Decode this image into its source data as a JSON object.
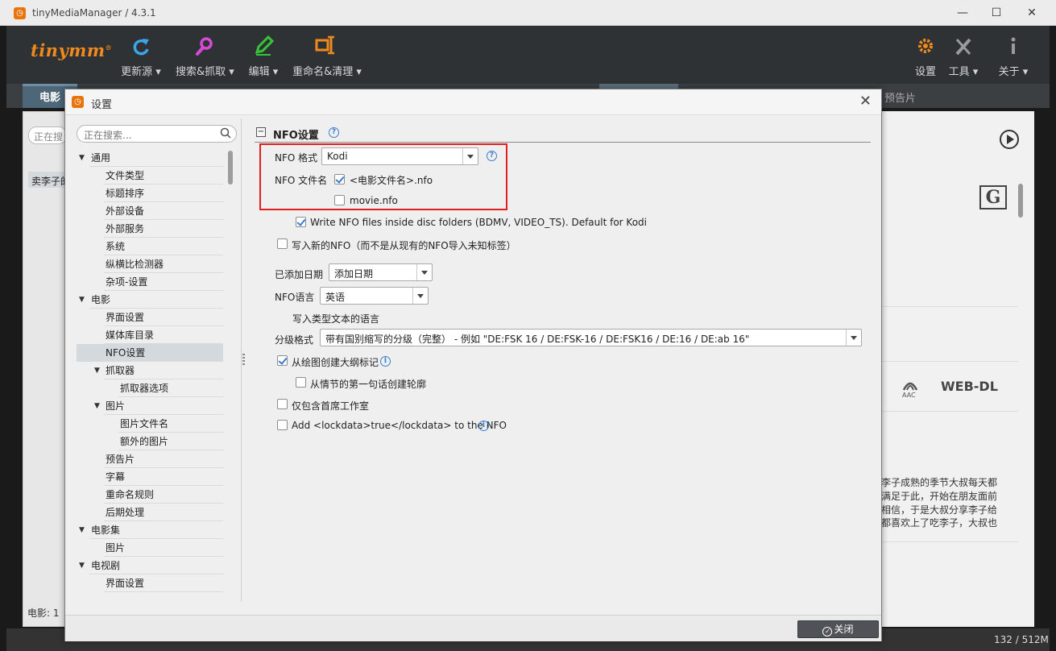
{
  "window": {
    "title": "tinyMediaManager / 4.3.1",
    "minimize": "—",
    "maximize": "☐",
    "close": "✕"
  },
  "toolbar": {
    "logo": "tinymm",
    "logo_mark": "®",
    "update_source": "更新源 ▾",
    "search_scrape": "搜索&抓取 ▾",
    "edit": "编辑 ▾",
    "rename_clean": "重命名&清理 ▾",
    "settings": "设置",
    "tools": "工具 ▾",
    "about": "关于 ▾"
  },
  "tabs": {
    "movie": "电影",
    "trailer": "预告片"
  },
  "background": {
    "search_placeholder": "正在搜",
    "selected_movie": "卖李子的",
    "status_count": "电影: 1",
    "memory": "132 / 512M",
    "rating_badge": "G",
    "web_dl": "WEB-DL",
    "aac": "AAC",
    "plot_lines": [
      "李子成熟的季节大叔每天都",
      "满足于此，开始在朋友面前",
      "相信，于是大叔分享李子给",
      "都喜欢上了吃李子，大叔也"
    ]
  },
  "dialog": {
    "title": "设置",
    "close_icon": "✕",
    "search_placeholder": "正在搜索...",
    "tree": [
      {
        "label": "通用",
        "level": 0,
        "expanded": true
      },
      {
        "label": "文件类型",
        "level": 1
      },
      {
        "label": "标题排序",
        "level": 1
      },
      {
        "label": "外部设备",
        "level": 1
      },
      {
        "label": "外部服务",
        "level": 1
      },
      {
        "label": "系统",
        "level": 1
      },
      {
        "label": "纵横比检测器",
        "level": 1
      },
      {
        "label": "杂项-设置",
        "level": 1
      },
      {
        "label": "电影",
        "level": 0,
        "expanded": true
      },
      {
        "label": "界面设置",
        "level": 1
      },
      {
        "label": "媒体库目录",
        "level": 1
      },
      {
        "label": "NFO设置",
        "level": 1,
        "selected": true
      },
      {
        "label": "抓取器",
        "level": 1,
        "expanded": true
      },
      {
        "label": "抓取器选项",
        "level": 2
      },
      {
        "label": "图片",
        "level": 1,
        "expanded": true
      },
      {
        "label": "图片文件名",
        "level": 2
      },
      {
        "label": "额外的图片",
        "level": 2
      },
      {
        "label": "预告片",
        "level": 1
      },
      {
        "label": "字幕",
        "level": 1
      },
      {
        "label": "重命名规则",
        "level": 1
      },
      {
        "label": "后期处理",
        "level": 1
      },
      {
        "label": "电影集",
        "level": 0,
        "expanded": true
      },
      {
        "label": "图片",
        "level": 1
      },
      {
        "label": "电视剧",
        "level": 0,
        "expanded": true
      },
      {
        "label": "界面设置",
        "level": 1
      }
    ],
    "panel": {
      "title": "NFO设置",
      "nfo_format_label": "NFO 格式",
      "nfo_format_value": "Kodi",
      "nfo_filename_label": "NFO 文件名",
      "nfo_filename_opt1": "<电影文件名>.nfo",
      "nfo_filename_opt1_checked": true,
      "nfo_filename_opt2": "movie.nfo",
      "nfo_filename_opt2_checked": false,
      "disc_folders": "Write NFO files inside disc folders (BDMV, VIDEO_TS). Default for Kodi",
      "disc_folders_checked": true,
      "write_new_nfo": "写入新的NFO（而不是从现有的NFO导入未知标签）",
      "write_new_nfo_checked": false,
      "date_added_label": "已添加日期",
      "date_added_value": "添加日期",
      "nfo_language_label": "NFO语言",
      "nfo_language_value": "英语",
      "genre_lang_note": "写入类型文本的语言",
      "certification_label": "分级格式",
      "certification_value": "带有国别缩写的分级（完整） - 例如 \"DE:FSK 16 / DE:FSK-16 / DE:FSK16 / DE:16 / DE:ab 16\"",
      "outline_from_plot": "从绘图创建大纲标记",
      "outline_from_plot_checked": true,
      "outline_first_sentence": "从情节的第一句话创建轮廓",
      "outline_first_sentence_checked": false,
      "first_studio_only": "仅包含首席工作室",
      "first_studio_only_checked": false,
      "lockdata": "Add <lockdata>true</lockdata> to the NFO",
      "lockdata_checked": false
    },
    "close_button": "关闭"
  },
  "colors": {
    "accent_orange": "#f08a1e",
    "check_blue": "#3a7cd0",
    "highlight_red": "#e02020"
  }
}
